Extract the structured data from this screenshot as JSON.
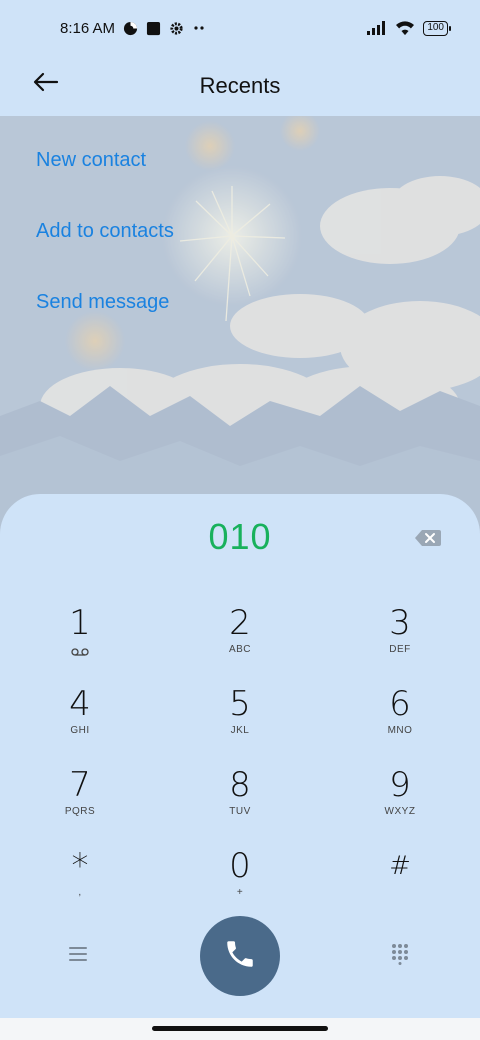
{
  "status_bar": {
    "time": "8:16 AM",
    "battery": "100",
    "icons": [
      "data-saver-icon",
      "square-app-icon",
      "gear-icon",
      "more-dots-icon",
      "signal-icon",
      "wifi-icon",
      "battery-icon"
    ]
  },
  "header": {
    "title": "Recents",
    "back_icon": "arrow-left-icon"
  },
  "actions": [
    {
      "label": "New contact"
    },
    {
      "label": "Add to contacts"
    },
    {
      "label": "Send message"
    }
  ],
  "dialpad": {
    "number": "010",
    "backspace_icon": "backspace-icon",
    "keys": [
      {
        "digit": "1",
        "letters": "",
        "sub_icon": "voicemail-icon"
      },
      {
        "digit": "2",
        "letters": "ABC"
      },
      {
        "digit": "3",
        "letters": "DEF"
      },
      {
        "digit": "4",
        "letters": "GHI"
      },
      {
        "digit": "5",
        "letters": "JKL"
      },
      {
        "digit": "6",
        "letters": "MNO"
      },
      {
        "digit": "7",
        "letters": "PQRS"
      },
      {
        "digit": "8",
        "letters": "TUV"
      },
      {
        "digit": "9",
        "letters": "WXYZ"
      },
      {
        "digit": "*",
        "letters": ","
      },
      {
        "digit": "0",
        "letters": "+"
      },
      {
        "digit": "#",
        "letters": ""
      }
    ]
  },
  "colors": {
    "accent_link": "#1a82e0",
    "number_green": "#18b15c",
    "call_button": "#4a6a8a",
    "panel_bg": "#cfe3f8"
  }
}
